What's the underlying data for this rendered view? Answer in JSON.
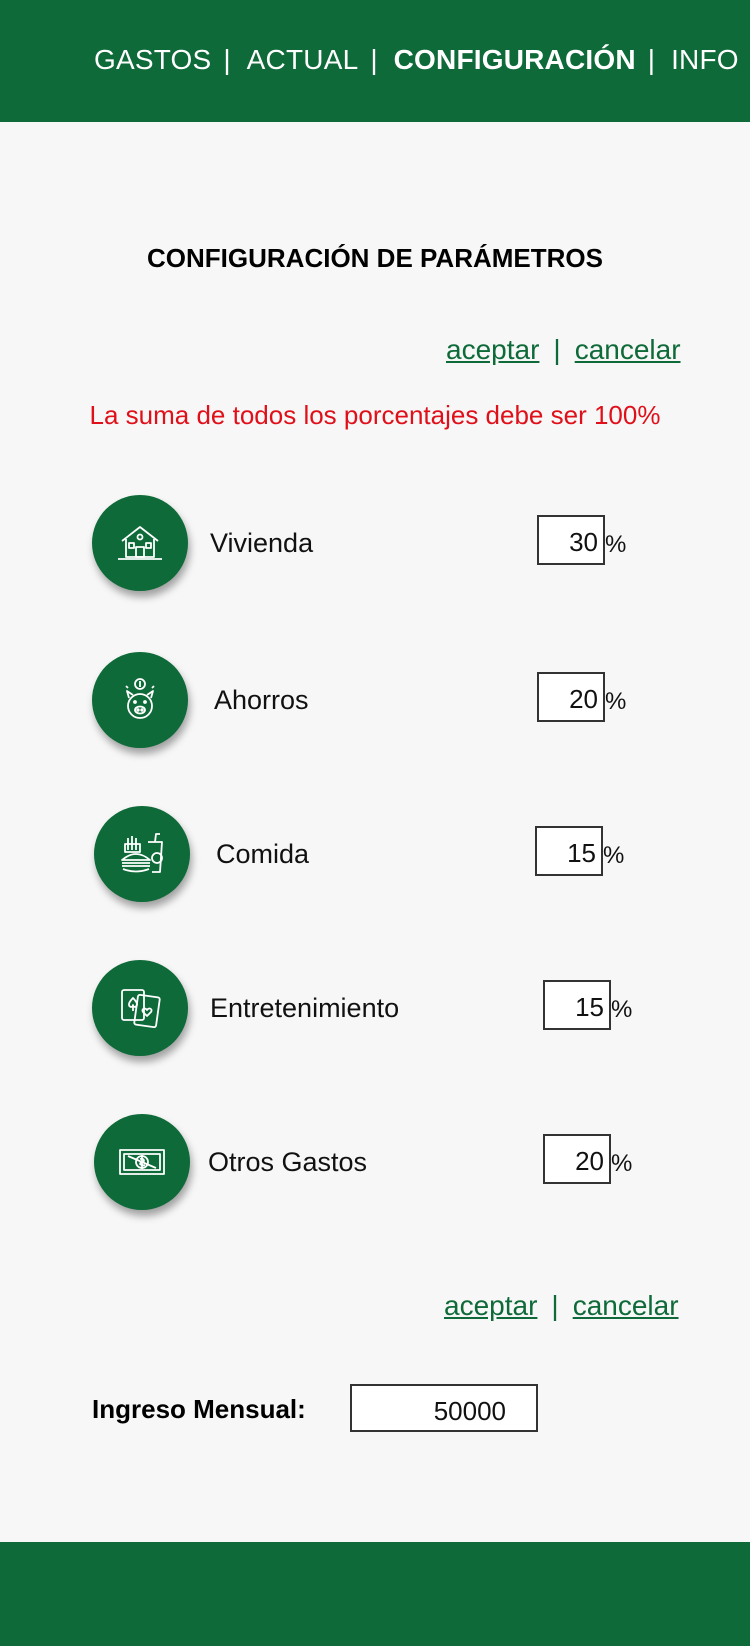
{
  "nav": {
    "items": [
      {
        "label": "GASTOS",
        "active": false
      },
      {
        "label": "ACTUAL",
        "active": false
      },
      {
        "label": "CONFIGURACIÓN",
        "active": true
      },
      {
        "label": "INFO",
        "active": false
      }
    ],
    "separator": "|"
  },
  "page": {
    "title": "CONFIGURACIÓN DE PARÁMETROS",
    "warning": "La suma de todos los porcentajes debe ser 100%"
  },
  "actions": {
    "accept_label": "aceptar",
    "cancel_label": "cancelar",
    "separator": "|"
  },
  "categories": [
    {
      "label": "Vivienda",
      "value": "30",
      "unit": "%",
      "icon": "house-icon"
    },
    {
      "label": "Ahorros",
      "value": "20",
      "unit": "%",
      "icon": "piggy-bank-icon"
    },
    {
      "label": "Comida",
      "value": "15",
      "unit": "%",
      "icon": "burger-drink-icon"
    },
    {
      "label": "Entretenimiento",
      "value": "15",
      "unit": "%",
      "icon": "playing-cards-icon"
    },
    {
      "label": "Otros Gastos",
      "value": "20",
      "unit": "%",
      "icon": "banknote-icon"
    }
  ],
  "income": {
    "label": "Ingreso Mensual:",
    "value": "50000"
  },
  "colors": {
    "brand_green": "#0e6a38",
    "warning_red": "#e0101a",
    "background": "#f7f7f7"
  }
}
